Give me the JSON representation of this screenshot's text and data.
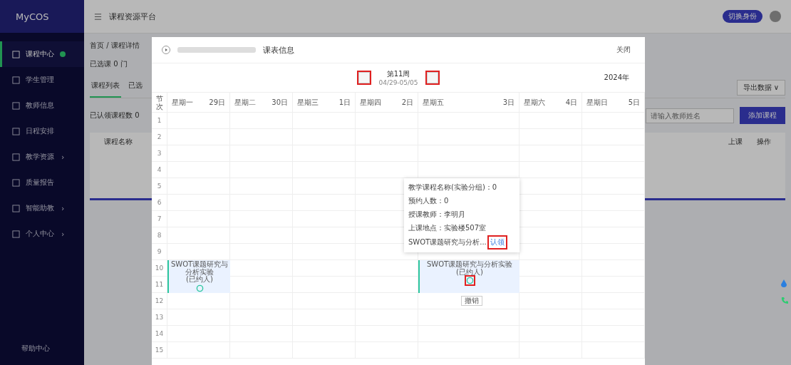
{
  "sidebar": {
    "logo": "MyCOS",
    "items": [
      {
        "label": "课程中心",
        "selected": true,
        "dot": true
      },
      {
        "label": "学生管理",
        "selected": false,
        "dot": false
      },
      {
        "label": "教师信息",
        "selected": false,
        "dot": false
      },
      {
        "label": "日程安排",
        "selected": false,
        "dot": false
      },
      {
        "label": "教学资源",
        "selected": false,
        "dot": false,
        "chevron": "›"
      },
      {
        "label": "质量报告",
        "selected": false,
        "dot": false
      },
      {
        "label": "智能助教",
        "selected": false,
        "dot": false,
        "chevron": "›"
      },
      {
        "label": "个人中心",
        "selected": false,
        "dot": false,
        "chevron": "›"
      }
    ],
    "footer": "帮助中心"
  },
  "topbar": {
    "title": "课程资源平台",
    "badge": "切换身份"
  },
  "page": {
    "breadcrumb": "首页 / 课程详情",
    "summary": "已选课 0 门",
    "tabs": [
      {
        "label": "课程列表",
        "selected": true
      },
      {
        "label": "已选",
        "selected": false
      }
    ],
    "export": "导出数据 ∨",
    "filter": "已认领课程数 0",
    "search_placeholder": "请输入教师姓名",
    "add_button": "添加课程",
    "columns": [
      "课程名称",
      "上课",
      "操作"
    ]
  },
  "modal": {
    "title": "课表信息",
    "close": "关闭",
    "week": {
      "label": "第11周",
      "range": "04/29-05/05",
      "prev_highlighted": true,
      "next_highlighted": true
    },
    "year": "2024年",
    "index_header": "节次",
    "days": [
      {
        "name": "星期一",
        "date": "29日",
        "event": {
          "title": "SWOT课题研究与分析实验",
          "note": "(已约人)",
          "icon_highlighted": false
        }
      },
      {
        "name": "星期二",
        "date": "30日"
      },
      {
        "name": "星期三",
        "date": "1日"
      },
      {
        "name": "星期四",
        "date": "2日"
      },
      {
        "name": "星期五",
        "date": "3日",
        "event": {
          "title": "SWOT课题研究与分析实验",
          "note": "(已约人)",
          "icon_highlighted": true,
          "tooltip": "撤销"
        },
        "popover": {
          "lines": [
            "教学课程名称(实验分组)：0",
            "预约人数：0",
            "授课教师：李明月",
            "上课地点：实验楼507室"
          ],
          "last": "SWOT课题研究与分析...",
          "action": "认领",
          "action_highlighted": true
        }
      },
      {
        "name": "星期六",
        "date": "4日"
      },
      {
        "name": "星期日",
        "date": "5日"
      }
    ],
    "periods": [
      "1",
      "2",
      "3",
      "4",
      "5",
      "6",
      "7",
      "8",
      "9",
      "10",
      "11",
      "12",
      "13",
      "14",
      "15"
    ]
  }
}
